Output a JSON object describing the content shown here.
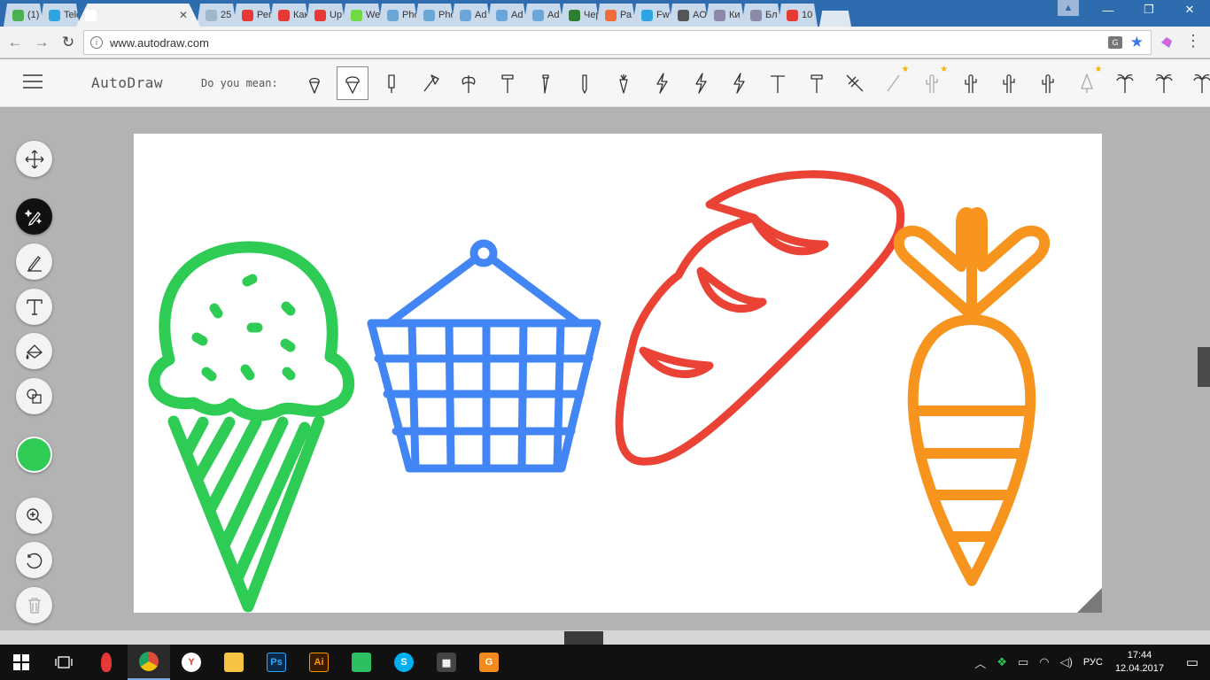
{
  "browser": {
    "tabs": [
      {
        "label": "(1)",
        "color": "#4caf50"
      },
      {
        "label": "Tele",
        "color": "#2ca5e0"
      },
      {
        "label": "",
        "color": "#ffffff",
        "active": true
      },
      {
        "label": "25",
        "color": "#9fb7c9"
      },
      {
        "label": "Рег",
        "color": "#e53935"
      },
      {
        "label": "Как",
        "color": "#e53935"
      },
      {
        "label": "Up",
        "color": "#e53935"
      },
      {
        "label": "We",
        "color": "#6fda44"
      },
      {
        "label": "Pho",
        "color": "#6aa7d8"
      },
      {
        "label": "Pho",
        "color": "#6aa7d8"
      },
      {
        "label": "Ad",
        "color": "#6aa7d8"
      },
      {
        "label": "Ad",
        "color": "#6aa7d8"
      },
      {
        "label": "Ad",
        "color": "#6aa7d8"
      },
      {
        "label": "Чер",
        "color": "#2e7d32"
      },
      {
        "label": "Ра",
        "color": "#ef6c3b"
      },
      {
        "label": "Fw",
        "color": "#2ca5e0"
      },
      {
        "label": "AO",
        "color": "#555555"
      },
      {
        "label": "Ки",
        "color": "#8a8aa8"
      },
      {
        "label": "Бл",
        "color": "#8a8aa8"
      },
      {
        "label": "10",
        "color": "#e53935"
      }
    ],
    "url": "www.autodraw.com",
    "window_controls": {
      "minimize": "—",
      "maximize": "❐",
      "close": "✕"
    }
  },
  "app": {
    "brand": "AutoDraw",
    "suggest_label": "Do you mean:",
    "suggestions": [
      {
        "icon": "ice-cream-icon"
      },
      {
        "icon": "ice-cream-cone-icon",
        "selected": true
      },
      {
        "icon": "popsicle-icon"
      },
      {
        "icon": "axe-icon"
      },
      {
        "icon": "double-axe-icon"
      },
      {
        "icon": "hammer-icon"
      },
      {
        "icon": "screw-icon"
      },
      {
        "icon": "pencil-icon"
      },
      {
        "icon": "carrot-icon"
      },
      {
        "icon": "lightning-icon"
      },
      {
        "icon": "lightning-icon"
      },
      {
        "icon": "lightning-icon"
      },
      {
        "icon": "t-tool-icon"
      },
      {
        "icon": "hammer-icon"
      },
      {
        "icon": "rake-icon"
      },
      {
        "icon": "wand-icon",
        "starred": true
      },
      {
        "icon": "cactus-icon",
        "starred": true
      },
      {
        "icon": "cactus-icon"
      },
      {
        "icon": "cactus-icon"
      },
      {
        "icon": "cactus-icon"
      },
      {
        "icon": "tree-icon",
        "starred": true
      },
      {
        "icon": "palm-tree-icon"
      },
      {
        "icon": "palm-tree-icon"
      },
      {
        "icon": "palm-tree-icon"
      }
    ],
    "tools": [
      "move-tool",
      "autodraw-tool",
      "draw-tool",
      "type-tool",
      "fill-tool",
      "shape-tool",
      "color-picker",
      "zoom-tool",
      "undo-tool",
      "delete-tool"
    ],
    "current_color": "#2ecc55",
    "drawing_colors": {
      "ice_cream": "#2ecc55",
      "basket": "#4285f4",
      "bread": "#ea4335",
      "carrot": "#f7941d"
    }
  },
  "taskbar": {
    "apps": [
      {
        "icon": "mic-icon",
        "color": "#e53935",
        "label": ""
      },
      {
        "icon": "chrome-icon",
        "color": "#dd4b39",
        "label": ""
      },
      {
        "icon": "yandex-icon",
        "color": "#ffffff",
        "label": "Y"
      },
      {
        "icon": "folder-icon",
        "color": "#f6c343",
        "label": ""
      },
      {
        "icon": "photoshop-icon",
        "color": "#0b2a4a",
        "label": "Ps"
      },
      {
        "icon": "illustrator-icon",
        "color": "#3a1a00",
        "label": "Ai"
      },
      {
        "icon": "evernote-icon",
        "color": "#2dbe60",
        "label": ""
      },
      {
        "icon": "skype-icon",
        "color": "#00aff0",
        "label": "S"
      },
      {
        "icon": "calculator-icon",
        "color": "#444444",
        "label": "▦"
      },
      {
        "icon": "app-icon",
        "color": "#f28a1e",
        "label": "G"
      }
    ],
    "language": "РУС",
    "time": "17:44",
    "date": "12.04.2017"
  }
}
